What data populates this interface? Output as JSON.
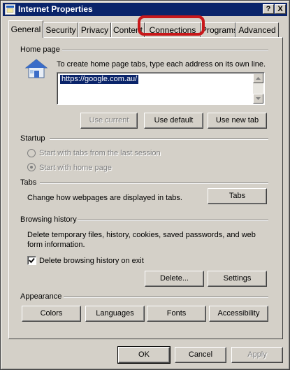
{
  "window": {
    "title": "Internet Properties",
    "help_label": "?",
    "close_label": "X"
  },
  "tabs": [
    {
      "label": "General"
    },
    {
      "label": "Security"
    },
    {
      "label": "Privacy"
    },
    {
      "label": "Content"
    },
    {
      "label": "Connections"
    },
    {
      "label": "Programs"
    },
    {
      "label": "Advanced"
    }
  ],
  "home_page": {
    "section_label": "Home page",
    "description": "To create home page tabs, type each address on its own line.",
    "url_value": "https://google.com.au/",
    "use_current_label": "Use current",
    "use_default_label": "Use default",
    "use_new_tab_label": "Use new tab"
  },
  "startup": {
    "section_label": "Startup",
    "option_last_session": "Start with tabs from the last session",
    "option_home_page": "Start with home page"
  },
  "tabs_section": {
    "section_label": "Tabs",
    "description": "Change how webpages are displayed in tabs.",
    "tabs_button_label": "Tabs"
  },
  "browsing_history": {
    "section_label": "Browsing history",
    "description_line1": "Delete temporary files, history, cookies, saved passwords, and web",
    "description_line2": "form information.",
    "delete_on_exit_label": "Delete browsing history on exit",
    "delete_on_exit_checked": true,
    "delete_button_label": "Delete...",
    "settings_button_label": "Settings"
  },
  "appearance": {
    "section_label": "Appearance",
    "colors_label": "Colors",
    "languages_label": "Languages",
    "fonts_label": "Fonts",
    "accessibility_label": "Accessibility"
  },
  "footer": {
    "ok_label": "OK",
    "cancel_label": "Cancel",
    "apply_label": "Apply"
  },
  "colors": {
    "titlebar": "#0a246a",
    "face": "#d4d0c8",
    "highlight_ring": "#c8181a"
  }
}
